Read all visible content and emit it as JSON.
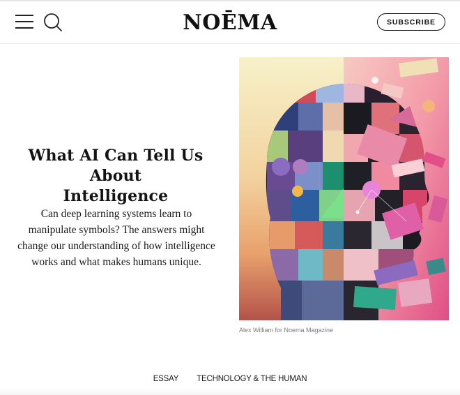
{
  "header": {
    "logo_text": "NOĒMA",
    "subscribe_label": "SUBSCRIBE",
    "menu_icon": "hamburger-menu-icon",
    "search_icon": "search-icon"
  },
  "article": {
    "headline_line1": "What AI Can Tell Us About",
    "headline_line2": "Intelligence",
    "dek_lines": [
      "Can deep learning systems learn to",
      "manipulate symbols? The answers might",
      "change our understanding of how intelligence",
      "works and what makes humans unique."
    ],
    "image_caption": "Alex William for Noema Magazine"
  },
  "tags": [
    "ESSAY",
    "TECHNOLOGY & THE HUMAN"
  ],
  "colors": {
    "text": "#111111",
    "caption": "#7a7a7a",
    "divider": "#ececec"
  }
}
